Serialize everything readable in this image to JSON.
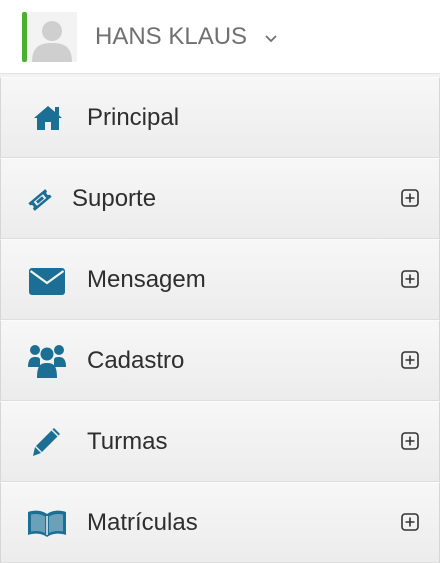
{
  "user": {
    "name": "HANS KLAUS"
  },
  "menu": {
    "items": [
      {
        "label": "Principal",
        "icon": "home-icon",
        "expandable": false
      },
      {
        "label": "Suporte",
        "icon": "ticket-icon",
        "expandable": true
      },
      {
        "label": "Mensagem",
        "icon": "envelope-icon",
        "expandable": true
      },
      {
        "label": "Cadastro",
        "icon": "users-icon",
        "expandable": true
      },
      {
        "label": "Turmas",
        "icon": "pencil-icon",
        "expandable": true
      },
      {
        "label": "Matrículas",
        "icon": "book-icon",
        "expandable": true
      }
    ]
  },
  "colors": {
    "icon": "#1b6f94",
    "accent": "#4caf30",
    "text": "#2e2e2e",
    "username": "#707070"
  }
}
